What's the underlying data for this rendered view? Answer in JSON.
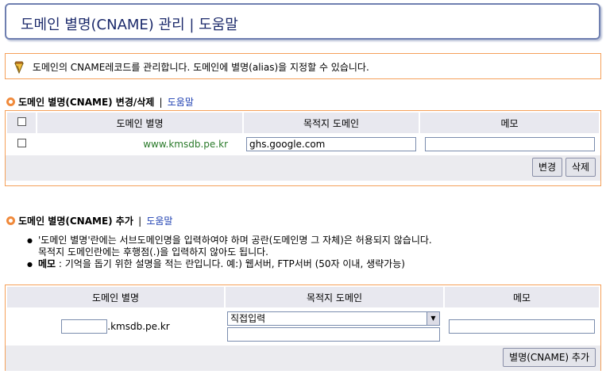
{
  "page": {
    "title": "도메인 별명(CNAME) 관리 | 도움말",
    "info": "도메인의 CNAME레코드를 관리합니다. 도메인에 별명(alias)을 지정할 수 있습니다."
  },
  "edit_section": {
    "title": "도메인 별명(CNAME) 변경/삭제",
    "sep": "|",
    "help_link": "도움말",
    "columns": [
      "도메인 별명",
      "목적지 도메인",
      "메모"
    ],
    "rows": [
      {
        "alias": "www.kmsdb.pe.kr",
        "target": "ghs.google.com",
        "memo": ""
      }
    ],
    "buttons": {
      "change": "변경",
      "delete": "삭제"
    }
  },
  "add_section": {
    "title": "도메인 별명(CNAME) 추가",
    "sep": "|",
    "help_link": "도움말",
    "notes": [
      "'도메인 별명'란에는 서브도메인명을 입력하여야 하며 공란(도메인명 그 자체)은 허용되지 않습니다.",
      "목적지 도메인란에는 후행점(.)을 입력하지 않아도 됩니다.",
      "메모 : 기억을 돕기 위한 설명을 적는 란입니다. 예:) 웹서버, FTP서버 (50자 이내, 생략가능)"
    ],
    "memo_bold": "메모",
    "memo_rest": " : 기억을 돕기 위한 설명을 적는 란입니다. 예:) 웹서버, FTP서버 (50자 이내, 생략가능)",
    "columns": [
      "도메인 별명",
      "목적지 도메인",
      "메모"
    ],
    "alias_value": "",
    "alias_suffix": ".kmsdb.pe.kr",
    "target_select": "직접입력",
    "target_value": "",
    "memo_value": "",
    "add_button": "별명(CNAME) 추가"
  }
}
